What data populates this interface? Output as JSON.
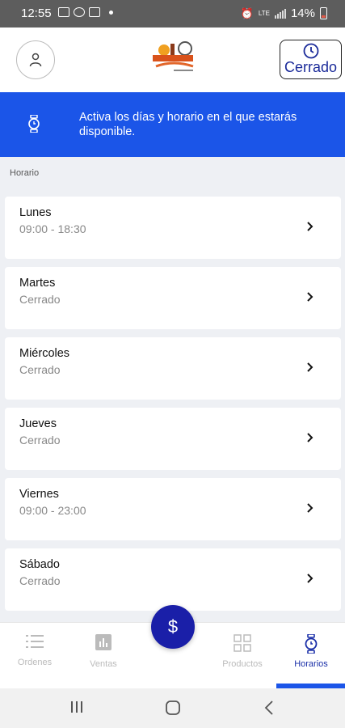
{
  "status_bar": {
    "time": "12:55",
    "battery": "14%",
    "network": "LTE"
  },
  "header": {
    "profile_icon": "user-icon",
    "status_button": {
      "icon": "clock-icon",
      "label": "Cerrado"
    }
  },
  "banner": {
    "icon": "watch-icon",
    "text": "Activa los días y horario en el que estarás disponible."
  },
  "section_title": "Horario",
  "days": [
    {
      "name": "Lunes",
      "hours": "09:00 - 18:30"
    },
    {
      "name": "Martes",
      "hours": "Cerrado"
    },
    {
      "name": "Miércoles",
      "hours": "Cerrado"
    },
    {
      "name": "Jueves",
      "hours": "Cerrado"
    },
    {
      "name": "Viernes",
      "hours": "09:00 - 23:00"
    },
    {
      "name": "Sábado",
      "hours": "Cerrado"
    }
  ],
  "bottom_nav": {
    "items": [
      {
        "label": "Ordenes",
        "icon": "list-icon"
      },
      {
        "label": "Ventas",
        "icon": "bar-chart-icon"
      },
      {
        "label": "Productos",
        "icon": "grid-icon"
      },
      {
        "label": "Horarios",
        "icon": "watch-icon",
        "active": true
      }
    ],
    "fab_label": "$"
  },
  "colors": {
    "primary": "#1b55e8",
    "fab": "#1a1fa8",
    "active_nav": "#1a2fa8"
  }
}
